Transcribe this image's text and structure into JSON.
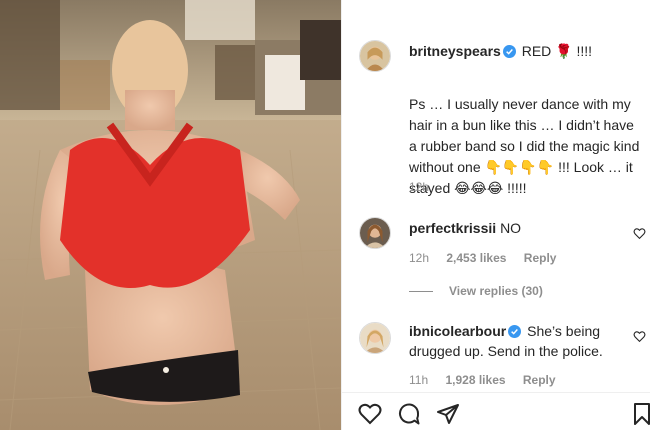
{
  "post": {
    "caption": {
      "username": "britneyspears",
      "headline": "RED 🌹 !!!!",
      "body": "Ps … I usually never dance with my hair in a bun like this … I didn’t have a rubber band so I did the magic kind without one 👇👇👇👇 !!! Look … it stayed 😂😂😂 !!!!!",
      "time": "12h"
    },
    "comments": [
      {
        "username": "perfectkrissii",
        "text": "NO",
        "time": "12h",
        "likes": "2,453 likes",
        "reply": "Reply",
        "view_replies": "View replies (30)"
      },
      {
        "username": "ibnicolearbour",
        "text": "She’s being drugged up. Send in the police.",
        "time": "11h",
        "likes": "1,928 likes",
        "reply": "Reply"
      }
    ]
  },
  "icons": {
    "verified": "verified-badge-icon",
    "like": "heart-icon",
    "comment": "comment-icon",
    "share": "share-icon",
    "save": "bookmark-icon"
  },
  "colors": {
    "verified": "#3897f0",
    "muted": "#8e8e8e",
    "text": "#262626"
  }
}
